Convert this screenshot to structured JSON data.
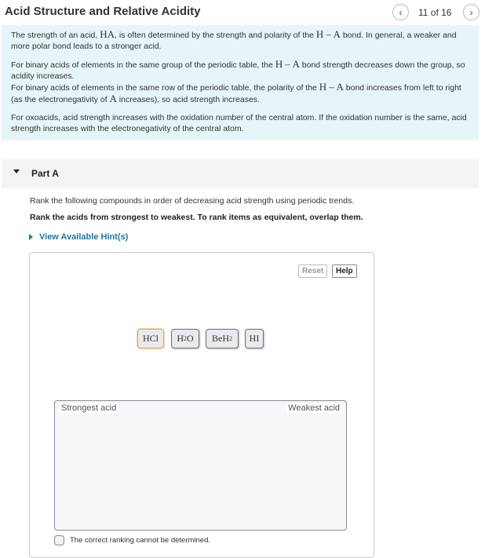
{
  "header": {
    "title": "Acid Structure and Relative Acidity",
    "prev_icon": "‹",
    "next_icon": "›",
    "page_counter": "11 of 16"
  },
  "intro": {
    "p1_a": "The strength of an acid, ",
    "p1_math1": "HA",
    "p1_b": ", is often determined by the strength and polarity of the ",
    "p1_math2": "H – A",
    "p1_c": " bond. In general, a weaker and more polar bond leads to a stronger acid.",
    "p2_a": "For binary acids of elements in the same group of the periodic table, the ",
    "p2_math": "H – A",
    "p2_b": " bond strength decreases down the group, so acidity increases.",
    "p3_a": "For binary acids of elements in the same row of the periodic table, the polarity of the ",
    "p3_math1": "H – A",
    "p3_b": " bond increases from left to right (as the electronegativity of ",
    "p3_math2": "A",
    "p3_c": " increases), so acid strength increases.",
    "p4": "For oxoacids, acid strength increases with the oxidation number of the central atom. If the oxidation number is the same, acid strength increases with the electronegativity of the central atom."
  },
  "part_a": {
    "label": "Part A",
    "instruction": "Rank the following compounds in order of decreasing acid strength using periodic trends.",
    "instruction_bold": "Rank the acids from strongest to weakest. To rank items as equivalent, overlap them.",
    "hint_label": "View Available Hint(s)",
    "reset_label": "Reset",
    "help_label": "Help",
    "chips": [
      {
        "base": "HCl",
        "sub": "",
        "tail": ""
      },
      {
        "base": "H",
        "sub": "2",
        "tail": "O"
      },
      {
        "base": "BeH",
        "sub": "2",
        "tail": ""
      },
      {
        "base": "HI",
        "sub": "",
        "tail": ""
      }
    ],
    "dropzone_left": "Strongest acid",
    "dropzone_right": "Weakest acid",
    "cannot_determine": "The correct ranking cannot be determined."
  }
}
